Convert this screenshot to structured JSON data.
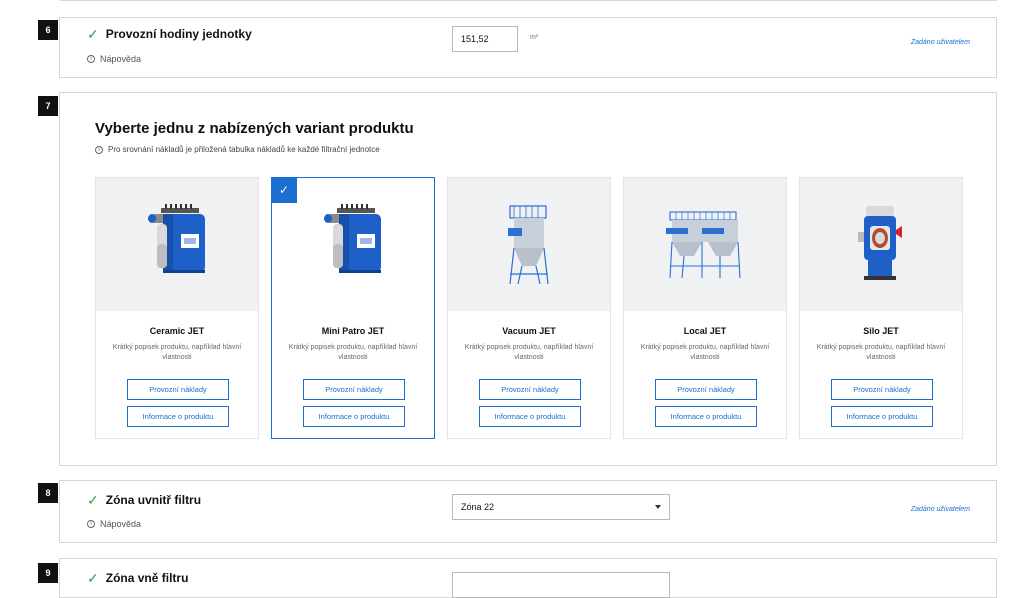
{
  "steps": {
    "s6": {
      "number": "6",
      "title": "Provozní hodiny jednotky",
      "help": "Nápověda",
      "value": "151,52",
      "unit": "m²",
      "note": "Zadáno uživatelem"
    },
    "s7": {
      "number": "7",
      "title": "Vyberte jednu z nabízených variant produktu",
      "help": "Pro srovnání nákladů je přiložená tabulka nákladů ke každé filtrační jednotce",
      "products": [
        {
          "name": "Ceramic JET",
          "desc": "Krátký popisek produktu, například hlavní vlastnosti",
          "btn1": "Provozní náklady",
          "btn2": "Informace o produktu",
          "selected": false,
          "icon": "ceramic-jet-image"
        },
        {
          "name": "Mini Patro JET",
          "desc": "Krátký popisek produktu, například hlavní vlastnosti",
          "btn1": "Provozní náklady",
          "btn2": "Informace o produktu",
          "selected": true,
          "icon": "mini-patro-jet-image"
        },
        {
          "name": "Vacuum JET",
          "desc": "Krátký popisek produktu, například hlavní vlastnosti",
          "btn1": "Provozní náklady",
          "btn2": "Informace o produktu",
          "selected": false,
          "icon": "vacuum-jet-image"
        },
        {
          "name": "Local JET",
          "desc": "Krátký popisek produktu, například hlavní vlastnosti",
          "btn1": "Provozní náklady",
          "btn2": "Informace o produktu",
          "selected": false,
          "icon": "local-jet-image"
        },
        {
          "name": "Silo JET",
          "desc": "Krátký popisek produktu, například hlavní vlastnosti",
          "btn1": "Provozní náklady",
          "btn2": "Informace o produktu",
          "selected": false,
          "icon": "silo-jet-image"
        }
      ]
    },
    "s8": {
      "number": "8",
      "title": "Zóna uvnitř filtru",
      "help": "Nápověda",
      "value": "Zóna 22",
      "note": "Zadáno uživatelem"
    },
    "s9": {
      "number": "9",
      "title": "Zóna vně filtru"
    }
  },
  "icons": {
    "check": "check-icon",
    "info": "info-icon",
    "caret": "chevron-down-icon"
  },
  "colors": {
    "accent": "#1a6fd1",
    "check": "#2aa24a",
    "step_badge": "#111111",
    "machine_blue": "#1f5fc8"
  }
}
